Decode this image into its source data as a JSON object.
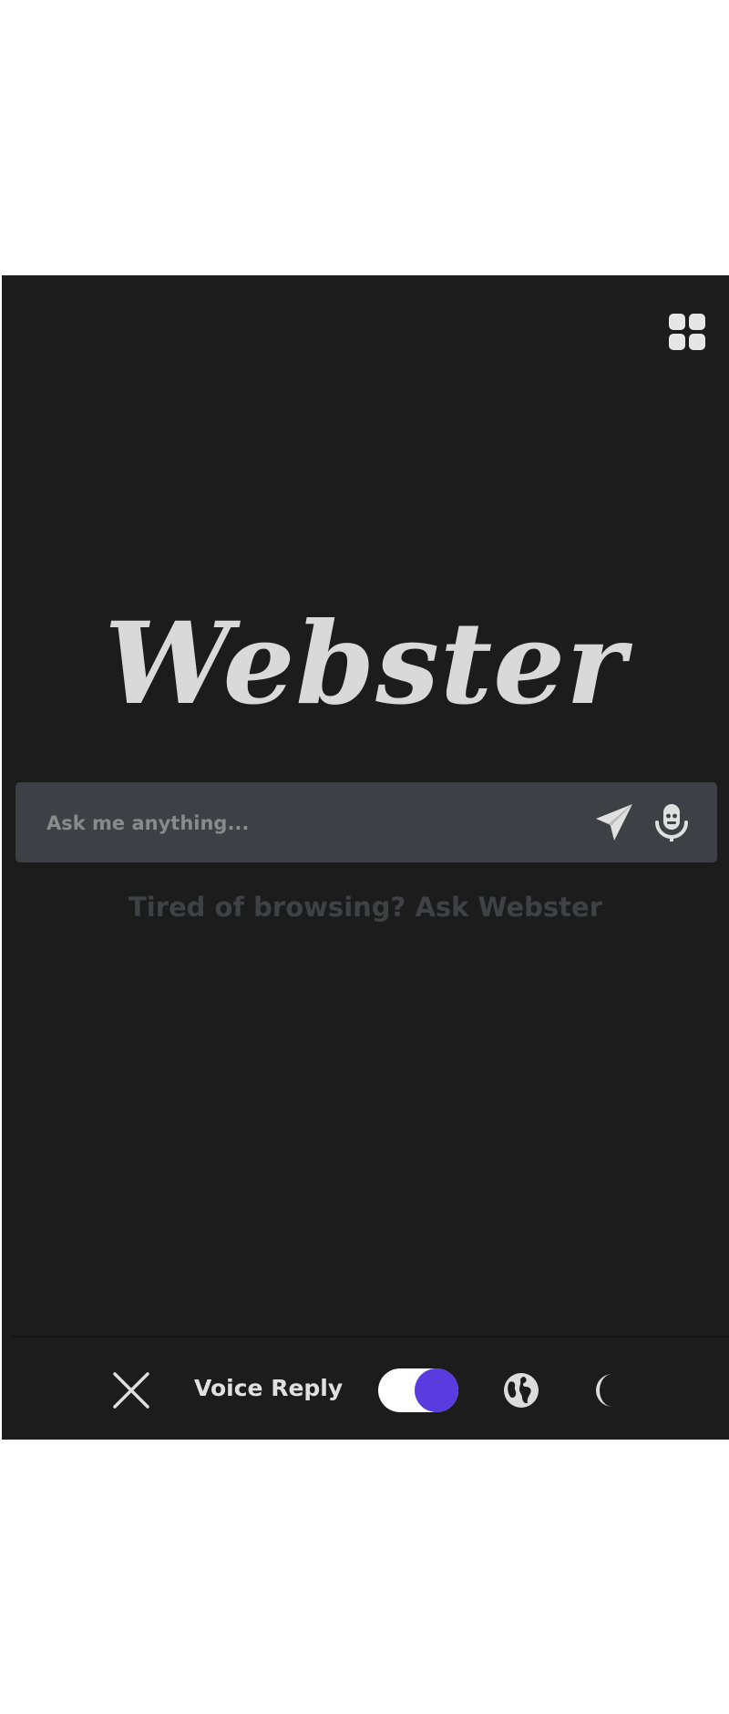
{
  "header": {
    "apps_icon": "grid-apps-icon"
  },
  "hero": {
    "logo_text": "Webster"
  },
  "search": {
    "placeholder": "Ask me anything...",
    "value": "",
    "send_icon": "paper-plane-icon",
    "mic_icon": "microphone-icon"
  },
  "tagline": "Tired of browsing? Ask Webster",
  "footer": {
    "close_icon": "close-icon",
    "voice_reply_label": "Voice Reply",
    "voice_reply_enabled": true,
    "globe_icon": "globe-icon",
    "theme_icon": "moon-icon"
  },
  "colors": {
    "background": "#1c1c1c",
    "search_bar": "#3e4045",
    "toggle_accent": "#5a3be0",
    "icon": "#dcdcdc",
    "tagline": "#3f4145"
  }
}
